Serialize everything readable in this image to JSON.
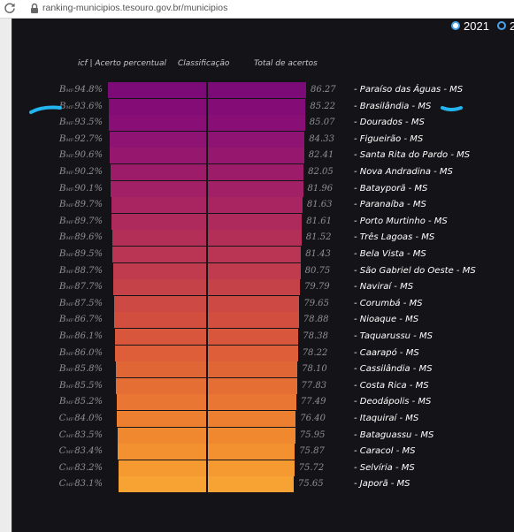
{
  "browser": {
    "url": "ranking-municipios.tesouro.gov.br/municipios"
  },
  "years": [
    {
      "label": "2021",
      "selected": true
    },
    {
      "label": "2",
      "selected": false
    }
  ],
  "headers": {
    "percent": "icf | Acerto percentual",
    "classification": "Classificação",
    "total": "Total de acertos"
  },
  "rows": [
    {
      "grade": "B",
      "grade_sub": "MF",
      "percent": "94.8%",
      "total": "86.27",
      "city": "- Paraíso das Águas - MS",
      "color": "#7c0a77"
    },
    {
      "grade": "B",
      "grade_sub": "MF",
      "percent": "93.6%",
      "total": "85.22",
      "city": "- Brasilândia - MS",
      "color": "#830c77"
    },
    {
      "grade": "B",
      "grade_sub": "MF",
      "percent": "93.5%",
      "total": "85.07",
      "city": "- Dourados - MS",
      "color": "#890f76"
    },
    {
      "grade": "B",
      "grade_sub": "MF",
      "percent": "92.7%",
      "total": "84.33",
      "city": "- Figueirão - MS",
      "color": "#8f1372"
    },
    {
      "grade": "B",
      "grade_sub": "MF",
      "percent": "90.6%",
      "total": "82.41",
      "city": "- Santa Rita do Pardo - MS",
      "color": "#96186e"
    },
    {
      "grade": "B",
      "grade_sub": "MF",
      "percent": "90.2%",
      "total": "82.05",
      "city": "- Nova Andradina - MS",
      "color": "#9c1c6a"
    },
    {
      "grade": "B",
      "grade_sub": "MF",
      "percent": "90.1%",
      "total": "81.96",
      "city": "- Batayporã - MS",
      "color": "#a22066"
    },
    {
      "grade": "B",
      "grade_sub": "MF",
      "percent": "89.7%",
      "total": "81.63",
      "city": "- Paranaíba - MS",
      "color": "#a82562"
    },
    {
      "grade": "B",
      "grade_sub": "MF",
      "percent": "89.7%",
      "total": "81.61",
      "city": "- Porto Murtinho - MS",
      "color": "#ae2a5d"
    },
    {
      "grade": "B",
      "grade_sub": "MF",
      "percent": "89.6%",
      "total": "81.52",
      "city": "- Três Lagoas - MS",
      "color": "#b42f58"
    },
    {
      "grade": "B",
      "grade_sub": "MF",
      "percent": "89.5%",
      "total": "81.43",
      "city": "- Bela Vista - MS",
      "color": "#ba3553"
    },
    {
      "grade": "B",
      "grade_sub": "MF",
      "percent": "88.7%",
      "total": "80.75",
      "city": "- São Gabriel do Oeste - MS",
      "color": "#c03b4e"
    },
    {
      "grade": "B",
      "grade_sub": "MF",
      "percent": "87.7%",
      "total": "79.79",
      "city": "- Naviraí - MS",
      "color": "#c64249"
    },
    {
      "grade": "B",
      "grade_sub": "MF",
      "percent": "87.5%",
      "total": "79.65",
      "city": "- Corumbá - MS",
      "color": "#cc4944"
    },
    {
      "grade": "B",
      "grade_sub": "MF",
      "percent": "86.7%",
      "total": "78.88",
      "city": "- Nioaque - MS",
      "color": "#d24f40"
    },
    {
      "grade": "B",
      "grade_sub": "MF",
      "percent": "86.1%",
      "total": "78.38",
      "city": "- Taquarussu - MS",
      "color": "#d8563c"
    },
    {
      "grade": "B",
      "grade_sub": "MF",
      "percent": "86.0%",
      "total": "78.22",
      "city": "- Caarapó - MS",
      "color": "#dd5e39"
    },
    {
      "grade": "B",
      "grade_sub": "MF",
      "percent": "85.8%",
      "total": "78.10",
      "city": "- Cassilândia - MS",
      "color": "#e16636"
    },
    {
      "grade": "B",
      "grade_sub": "MF",
      "percent": "85.5%",
      "total": "77.83",
      "city": "- Costa Rica - MS",
      "color": "#e56e34"
    },
    {
      "grade": "B",
      "grade_sub": "MF",
      "percent": "85.2%",
      "total": "77.49",
      "city": "- Deodápolis - MS",
      "color": "#e97632"
    },
    {
      "grade": "C",
      "grade_sub": "MF",
      "percent": "84.0%",
      "total": "76.40",
      "city": "- Itaquiraí - MS",
      "color": "#ed7f31"
    },
    {
      "grade": "C",
      "grade_sub": "MF",
      "percent": "83.5%",
      "total": "75.95",
      "city": "- Bataguassu - MS",
      "color": "#f08830"
    },
    {
      "grade": "C",
      "grade_sub": "MF",
      "percent": "83.4%",
      "total": "75.87",
      "city": "- Caracol - MS",
      "color": "#f39130"
    },
    {
      "grade": "C",
      "grade_sub": "MF",
      "percent": "83.2%",
      "total": "75.72",
      "city": "- Selvíria - MS",
      "color": "#f59a31"
    },
    {
      "grade": "C",
      "grade_sub": "MF",
      "percent": "83.1%",
      "total": "75.65",
      "city": "- Japorã - MS",
      "color": "#f7a333"
    }
  ],
  "colors": {
    "background": "#141418",
    "annotation": "#22b5f0",
    "radio_accent": "#4aa3e8"
  }
}
